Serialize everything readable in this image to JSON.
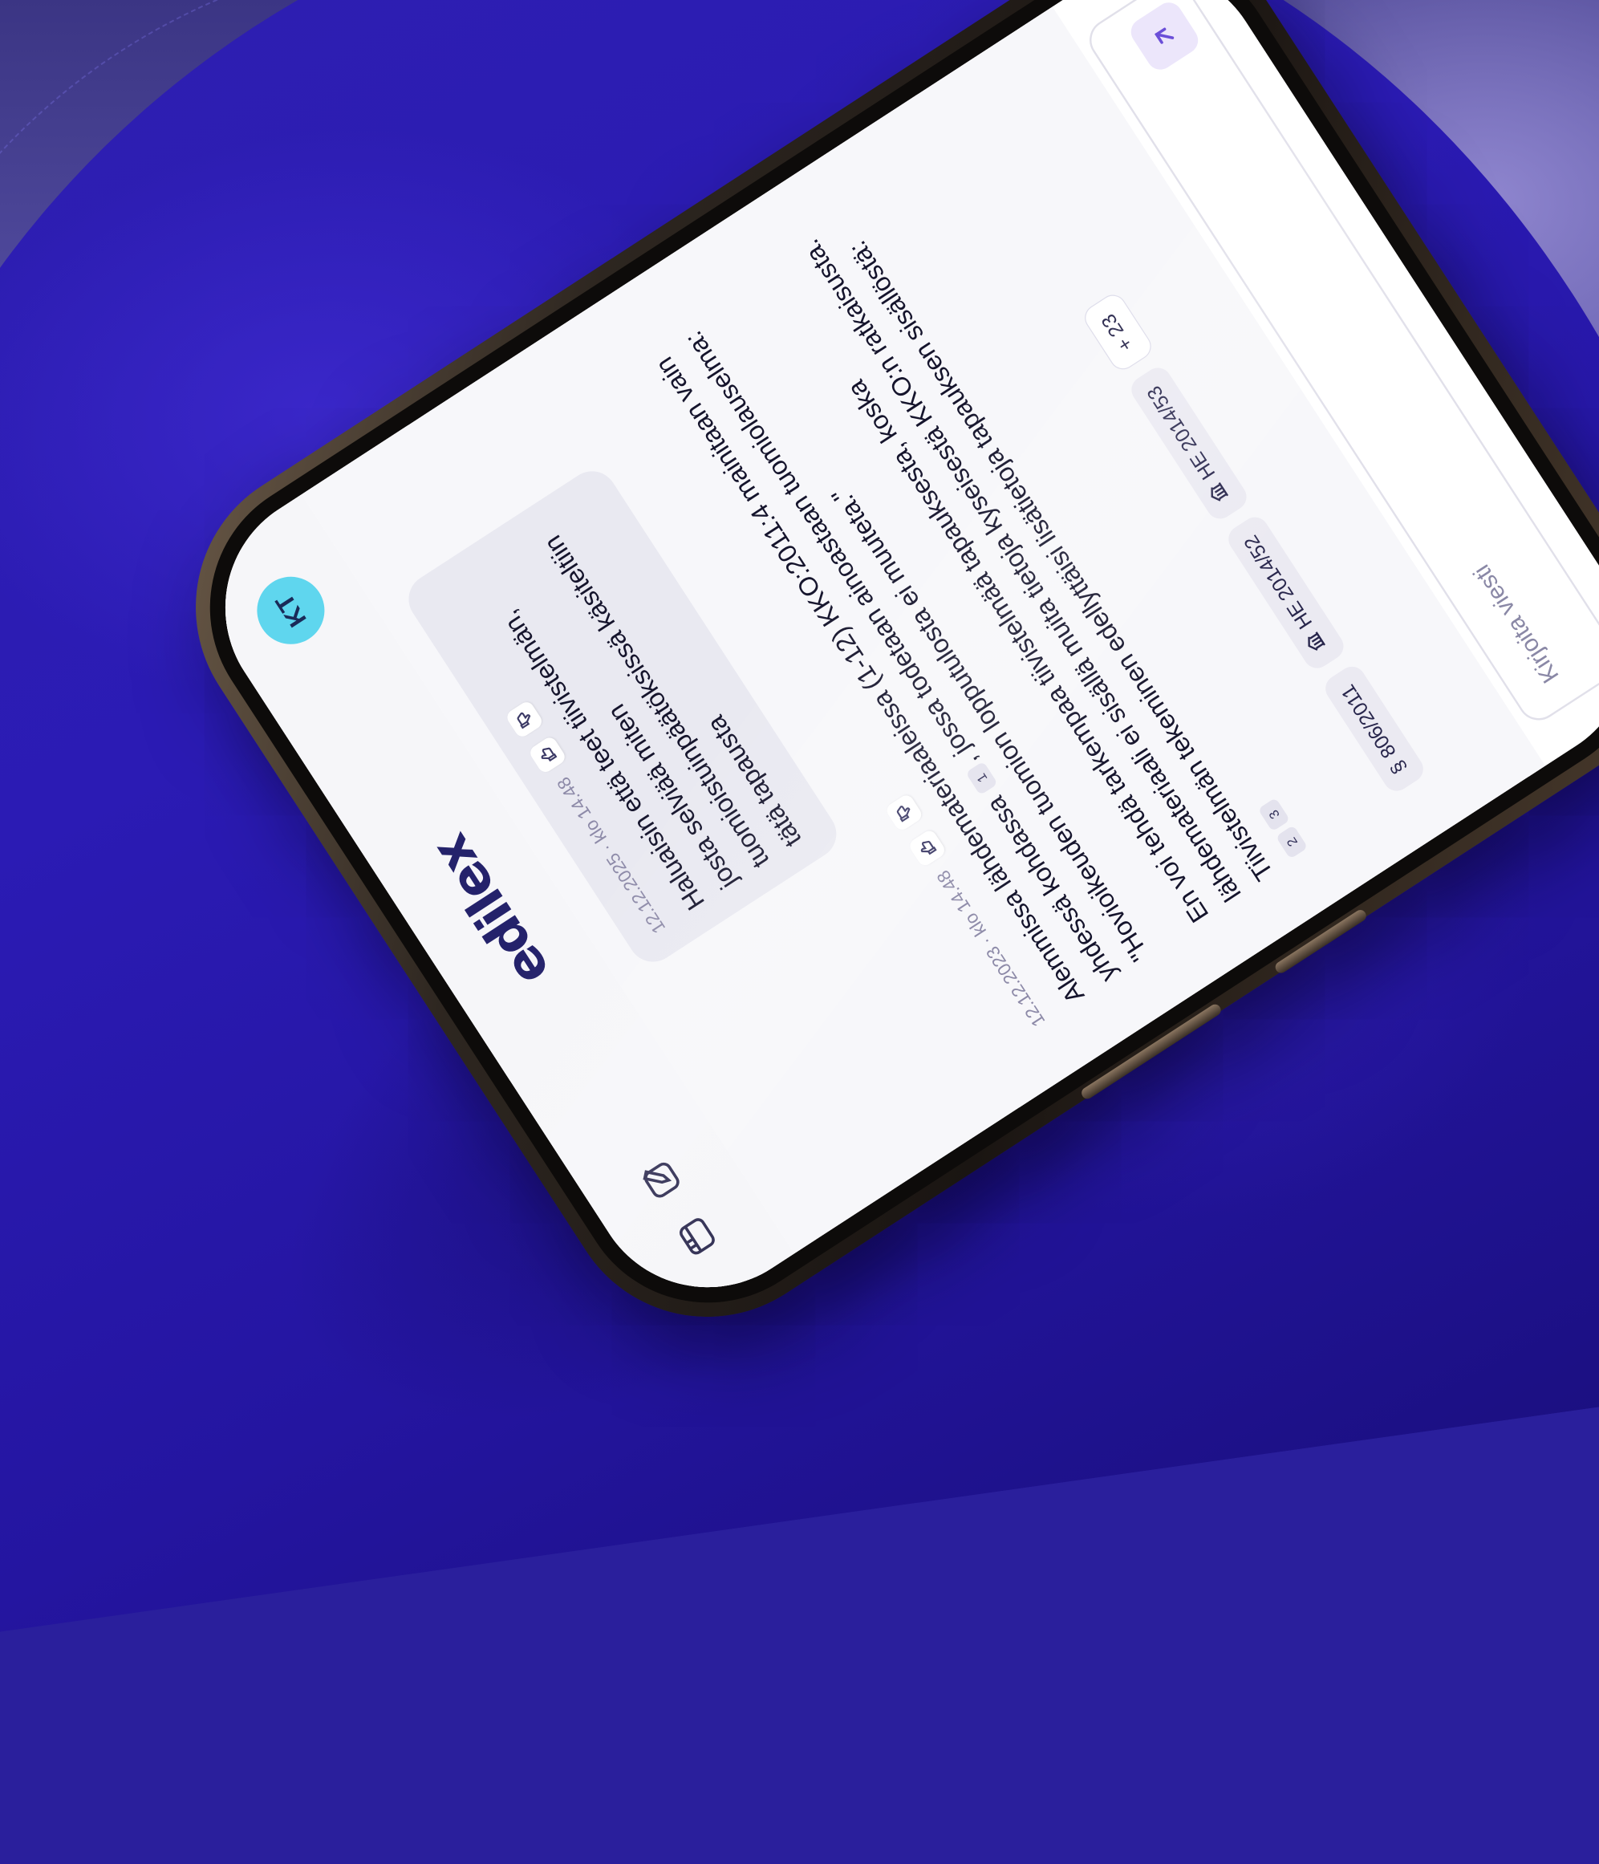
{
  "app": {
    "brand": "edilex",
    "user_initials": "KT"
  },
  "user_message": {
    "timestamp": "12.12.2025 · klo 14.48",
    "text": "Haluaisin että teet tiivistelmän, josta selviää miten tuomioistuinpäätöksissä käsiteltiin tätä tapausta"
  },
  "bot_message": {
    "timestamp": "12.12.2023 · klo 14.48",
    "paragraph1_a": "Alemmissa lähdemateriaaleissa (1-12) KKO:2011:4 mainitaan vain yhdessä kohdassa",
    "paragraph1_ref": "1",
    "paragraph1_b": ", jossa todetaan ainoastaan tuomiolauselma: \"Hovioikeuden tuomion lopputulosta ei muuteta.\"",
    "paragraph2": "En voi tehdä tarkempaa tiivistelmää tapauksesta, koska lähdemateriaali ei sisällä muita tietoja kyseisestä KKO:n ratkaisusta. Tiivistelmän tekeminen edellyttäisi lisätietoja tapauksen sisällöstä:",
    "paragraph2_refs": [
      "2",
      "3"
    ]
  },
  "sources": [
    {
      "label": "806/2011",
      "icon": "section-icon"
    },
    {
      "label": "HE 2014/52",
      "icon": "building-icon"
    },
    {
      "label": "HE 2014/53",
      "icon": "building-icon"
    }
  ],
  "sources_more": "+ 23",
  "composer": {
    "placeholder": "Kirjoita viesti"
  },
  "colors": {
    "brand": "#24226b",
    "avatar": "#5fd6ee",
    "send_button": "#ece6fb",
    "background_fabric": "#2b1bb4"
  }
}
